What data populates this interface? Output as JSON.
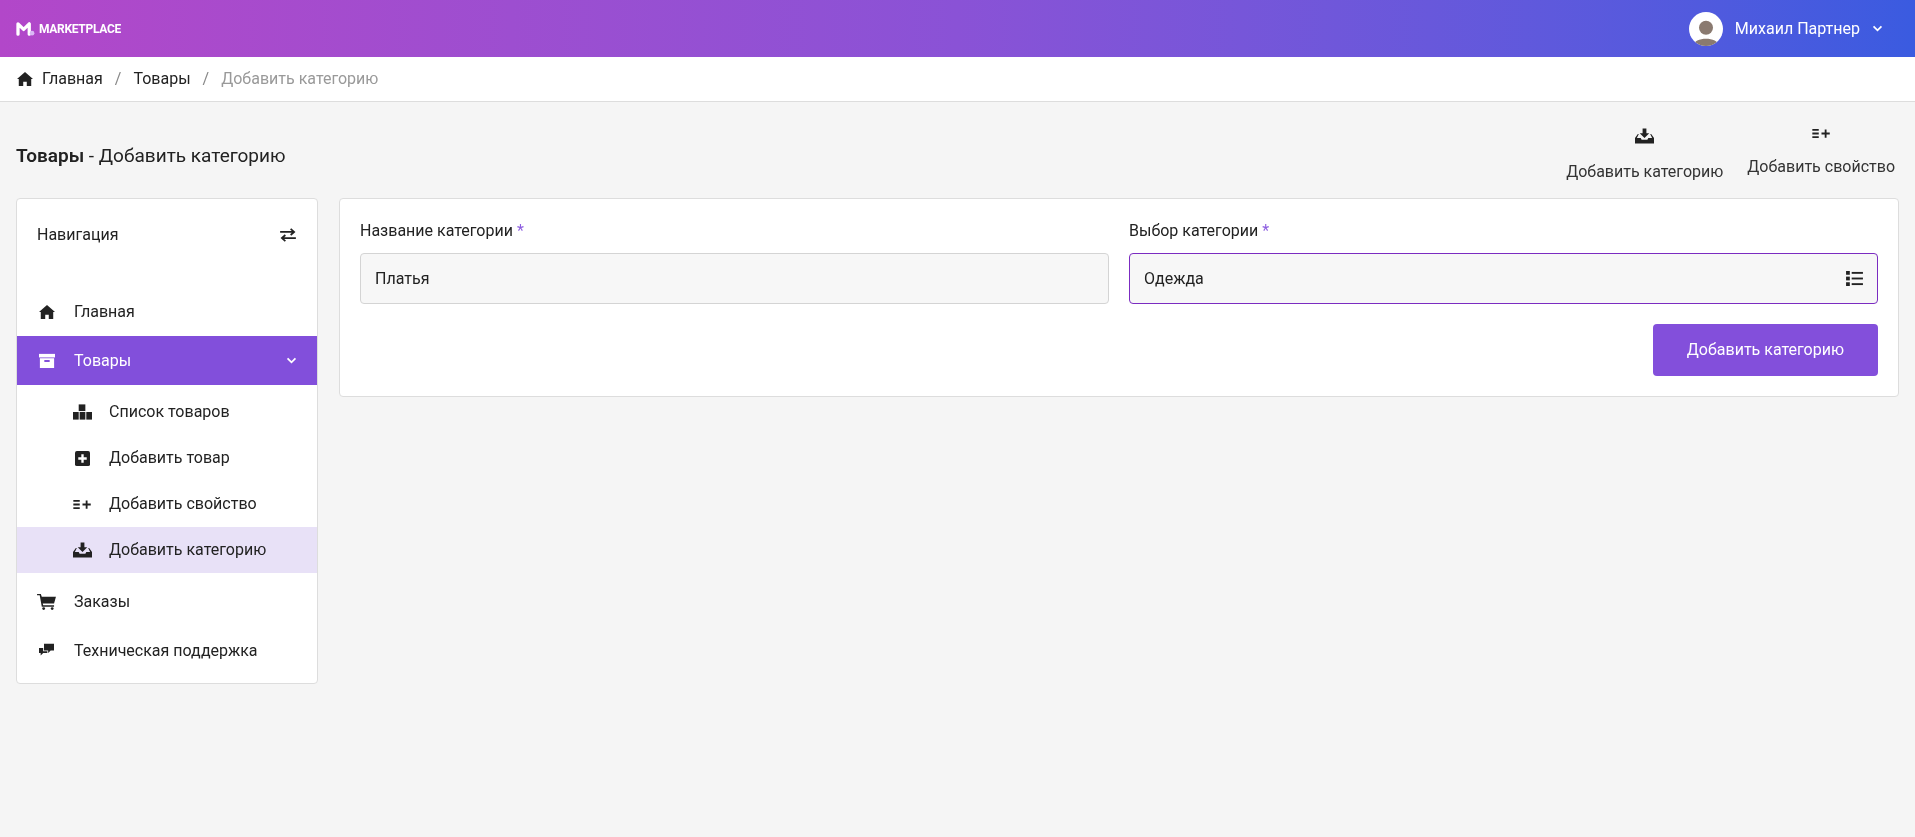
{
  "header": {
    "logo_text": "MARKETPLACE",
    "user_name": "Михаил Партнер"
  },
  "breadcrumbs": [
    {
      "label": "Главная",
      "current": false
    },
    {
      "separator": "/",
      "label": "Товары",
      "current": false
    },
    {
      "separator": "/",
      "label": "Добавить категорию",
      "current": true
    }
  ],
  "page_title": {
    "section": "Товары",
    "rest": " - Добавить категорию"
  },
  "actions": [
    {
      "label": "Добавить категорию"
    },
    {
      "label": "Добавить свойство"
    }
  ],
  "sidebar": {
    "title": "Навигация",
    "items": [
      {
        "label": "Главная",
        "selected": false
      },
      {
        "label": "Товары",
        "selected": true,
        "expanded": true,
        "children": [
          {
            "label": "Список товаров",
            "selected": false
          },
          {
            "label": "Добавить товар",
            "selected": false
          },
          {
            "label": "Добавить свойство",
            "selected": false
          },
          {
            "label": "Добавить категорию",
            "selected": true
          }
        ]
      },
      {
        "label": "Заказы",
        "selected": false
      },
      {
        "label": "Техническая поддержка",
        "selected": false
      }
    ]
  },
  "form": {
    "fields": [
      {
        "kind": "text",
        "label": "Название категории",
        "required_mark": "*",
        "value": "Платья",
        "focused": false
      },
      {
        "kind": "select",
        "label": "Выбор категории",
        "required_mark": "*",
        "value": "Одежда",
        "focused": true
      }
    ],
    "submit": "Добавить категорию"
  }
}
